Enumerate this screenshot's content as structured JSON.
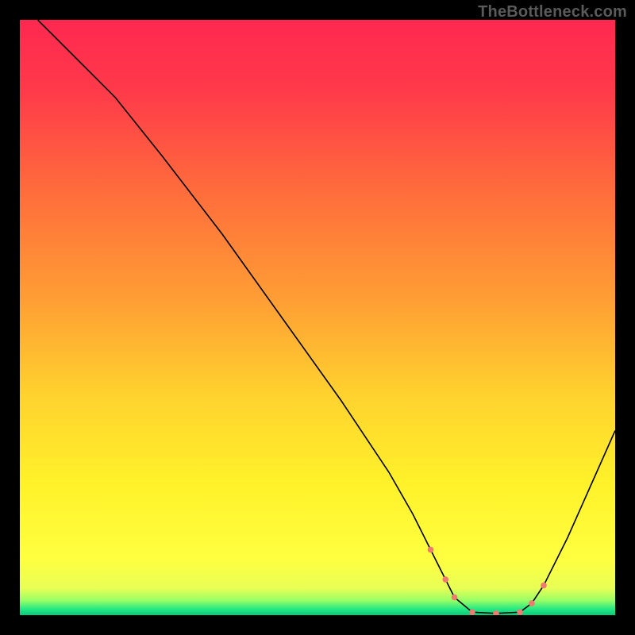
{
  "watermark": "TheBottleneck.com",
  "chart_data": {
    "type": "line",
    "title": "",
    "xlabel": "",
    "ylabel": "",
    "xlim": [
      0,
      100
    ],
    "ylim": [
      0,
      100
    ],
    "grid": false,
    "gradient_stops": [
      {
        "pos": 0.0,
        "color": "#ff2850"
      },
      {
        "pos": 0.12,
        "color": "#ff3a4a"
      },
      {
        "pos": 0.28,
        "color": "#ff6a3c"
      },
      {
        "pos": 0.47,
        "color": "#ff9e34"
      },
      {
        "pos": 0.63,
        "color": "#ffd22e"
      },
      {
        "pos": 0.78,
        "color": "#fff22a"
      },
      {
        "pos": 0.905,
        "color": "#ffff40"
      },
      {
        "pos": 0.955,
        "color": "#e8ff55"
      },
      {
        "pos": 0.975,
        "color": "#99ff66"
      },
      {
        "pos": 0.99,
        "color": "#22e884"
      },
      {
        "pos": 1.0,
        "color": "#0aca7a"
      }
    ],
    "series": [
      {
        "name": "bottleneck-curve",
        "color": "#000000",
        "stroke_width": 1.6,
        "x": [
          3,
          6,
          10,
          16,
          24,
          34,
          44,
          54,
          62,
          66,
          69,
          71.5,
          73,
          76,
          80,
          84,
          86,
          88,
          92,
          96,
          100
        ],
        "y": [
          100,
          97,
          93,
          87,
          77,
          64,
          50,
          36,
          24,
          17,
          11,
          6,
          3,
          0.5,
          0.3,
          0.5,
          2,
          5,
          13,
          22,
          31
        ]
      }
    ],
    "highlight_segment": {
      "name": "sweet-spot",
      "color": "#ef7a6f",
      "dot_radius": 3.8,
      "x": [
        69,
        71.5,
        73,
        76,
        80,
        84,
        86,
        88
      ],
      "y": [
        11,
        6,
        3,
        0.5,
        0.3,
        0.5,
        2,
        5
      ]
    }
  }
}
